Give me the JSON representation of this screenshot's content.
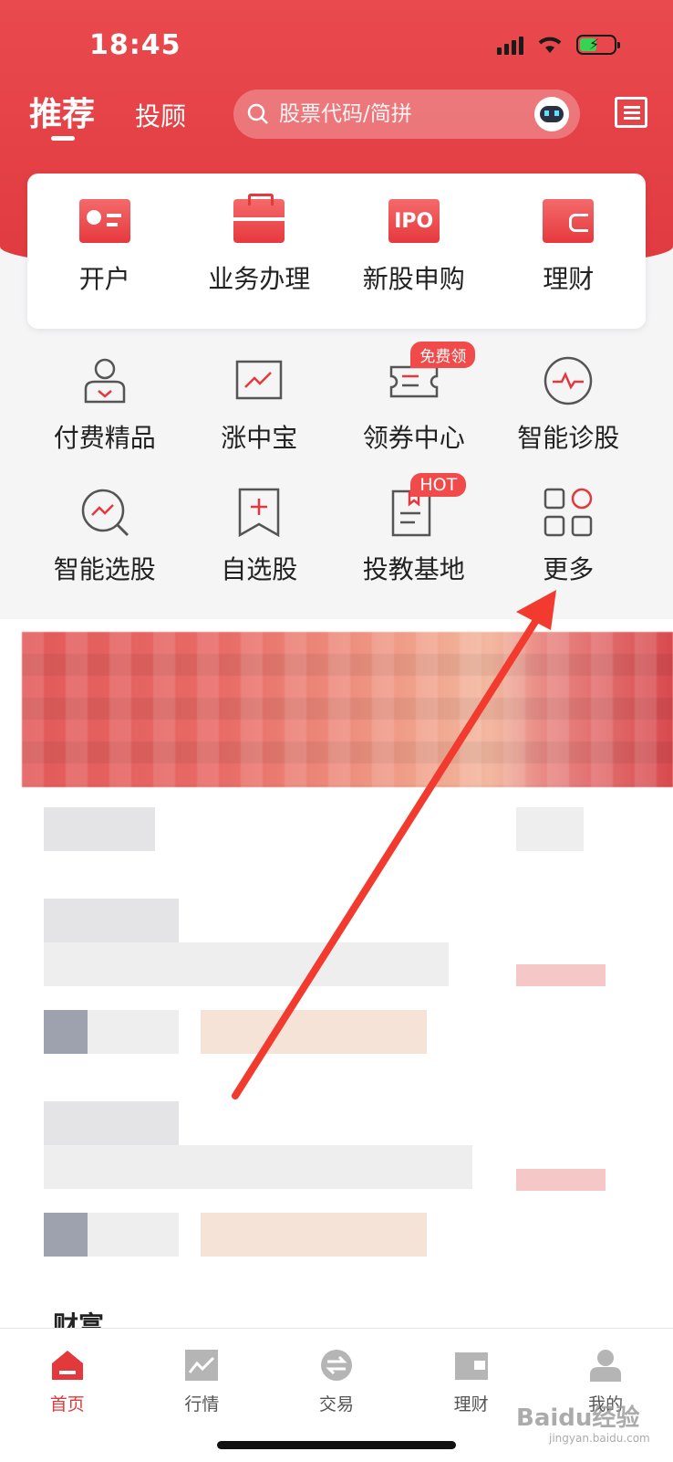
{
  "status_bar": {
    "time": "18:45"
  },
  "header": {
    "tab_recommend": "推荐",
    "tab_advisor": "投顾",
    "search_placeholder": "股票代码/简拼"
  },
  "main_card": [
    {
      "label": "开户",
      "icon": "id-card-icon"
    },
    {
      "label": "业务办理",
      "icon": "briefcase-icon"
    },
    {
      "label": "新股申购",
      "icon": "ipo-ticket-icon",
      "icon_text": "IPO"
    },
    {
      "label": "理财",
      "icon": "wallet-icon"
    }
  ],
  "grid_row1": [
    {
      "label": "付费精品",
      "icon": "user-heart-icon"
    },
    {
      "label": "涨中宝",
      "icon": "trend-chart-icon"
    },
    {
      "label": "领券中心",
      "icon": "coupon-icon",
      "badge": "免费领"
    },
    {
      "label": "智能诊股",
      "icon": "pulse-icon"
    }
  ],
  "grid_row2": [
    {
      "label": "智能选股",
      "icon": "search-trend-icon"
    },
    {
      "label": "自选股",
      "icon": "bookmark-plus-icon"
    },
    {
      "label": "投教基地",
      "icon": "book-icon",
      "badge": "HOT"
    },
    {
      "label": "更多",
      "icon": "grid-more-icon"
    }
  ],
  "partial_section_title": "财富",
  "tabbar": [
    {
      "label": "首页",
      "icon": "home-icon",
      "active": true
    },
    {
      "label": "行情",
      "icon": "chart-icon",
      "active": false
    },
    {
      "label": "交易",
      "icon": "exchange-icon",
      "active": false
    },
    {
      "label": "理财",
      "icon": "wallet-icon",
      "active": false
    },
    {
      "label": "我的",
      "icon": "user-icon",
      "active": false
    }
  ],
  "watermark": {
    "brand": "Baidu经验",
    "sub": "jingyan.baidu.com"
  },
  "colors": {
    "brand_red": "#e4393c",
    "header_red": "#e94a4e",
    "annotation_arrow": "#f23b2e"
  }
}
